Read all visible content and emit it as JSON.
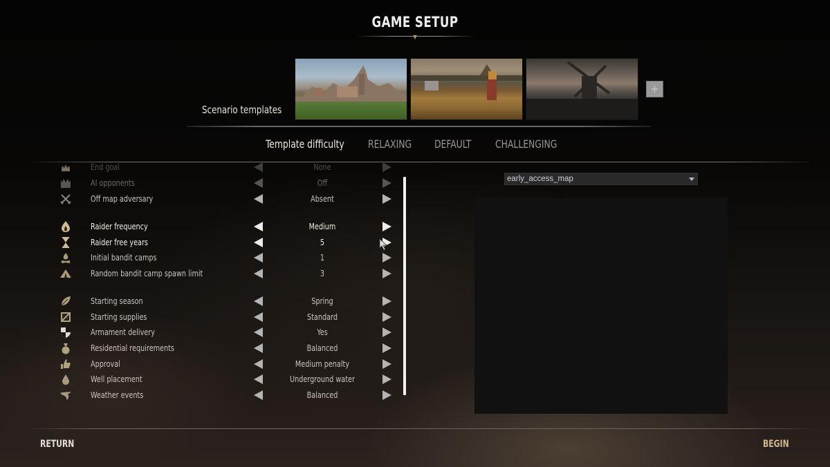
{
  "header": {
    "title": "GAME SETUP"
  },
  "scenario_templates": {
    "label": "Scenario templates",
    "thumbnails": [
      {
        "name": "town-on-hill",
        "icon": "landscape-icon"
      },
      {
        "name": "wheat-field",
        "icon": "landscape-icon"
      },
      {
        "name": "windmill",
        "icon": "landscape-icon"
      }
    ],
    "add_button": "+"
  },
  "difficulty": {
    "label": "Template difficulty",
    "options": [
      "RELAXING",
      "DEFAULT",
      "CHALLENGING"
    ]
  },
  "settings": [
    {
      "label": "End goal",
      "value": "None",
      "icon": "crown-icon",
      "state": "cut"
    },
    {
      "label": "AI opponents",
      "value": "Off",
      "icon": "castle-crown-icon",
      "state": "dim"
    },
    {
      "label": "Off map adversary",
      "value": "Absent",
      "icon": "crossed-swords-icon",
      "state": "normal"
    },
    {
      "label": "Raider frequency",
      "value": "Medium",
      "icon": "flame-icon",
      "state": "bright"
    },
    {
      "label": "Raider free years",
      "value": "5",
      "icon": "hourglass-icon",
      "state": "bright"
    },
    {
      "label": "Initial bandit camps",
      "value": "1",
      "icon": "campfire-icon",
      "state": "normal"
    },
    {
      "label": "Random bandit camp spawn limit",
      "value": "3",
      "icon": "tent-icon",
      "state": "normal"
    },
    {
      "label": "Starting season",
      "value": "Spring",
      "icon": "leaf-icon",
      "state": "normal"
    },
    {
      "label": "Starting supplies",
      "value": "Standard",
      "icon": "crate-icon",
      "state": "normal"
    },
    {
      "label": "Armament delivery",
      "value": "Yes",
      "icon": "shield-icon",
      "state": "normal"
    },
    {
      "label": "Residential requirements",
      "value": "Balanced",
      "icon": "sack-icon",
      "state": "normal"
    },
    {
      "label": "Approval",
      "value": "Medium penalty",
      "icon": "thumbs-up-icon",
      "state": "normal"
    },
    {
      "label": "Well placement",
      "value": "Underground water",
      "icon": "water-drop-icon",
      "state": "normal"
    },
    {
      "label": "Weather events",
      "value": "Balanced",
      "icon": "wind-icon",
      "state": "normal"
    }
  ],
  "map": {
    "selected": "early_access_map"
  },
  "footer": {
    "return_label": "RETURN",
    "begin_label": "BEGIN"
  },
  "colors": {
    "accent": "#d2b890",
    "text": "#c8c4bc",
    "panel": "#111112"
  }
}
